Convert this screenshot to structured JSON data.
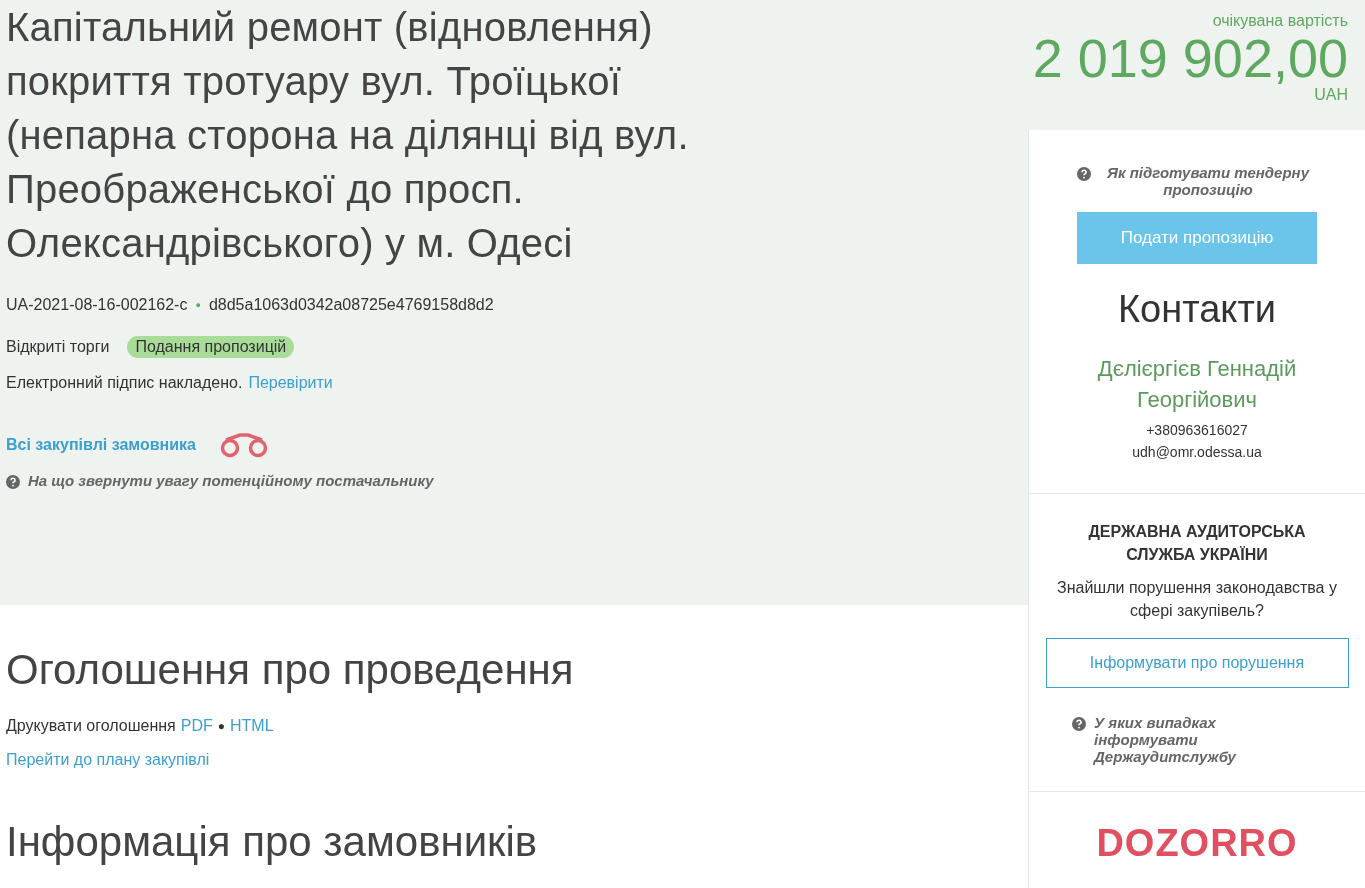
{
  "tender": {
    "title": "Капітальний ремонт (відновлення) покриття тротуару вул. Троїцької (непарна сторона на ділянці від вул. Преображенської до просп. Олександрівського) у м. Одесі",
    "id": "UA-2021-08-16-002162-c",
    "separator": "●",
    "hash": "d8d5a1063d0342a08725e4769158d8d2",
    "procedure": "Відкриті торги",
    "status": "Подання пропозицій",
    "signature_text": "Електронний підпис накладено.",
    "signature_link": "Перевірити",
    "buyer_link": "Всі закупівлі замовника",
    "hint": "На що звернути увагу потенційному постачальнику"
  },
  "budget": {
    "label": "очікувана вартість",
    "amount": "2 019 902,00",
    "currency": "UAH"
  },
  "sidebar": {
    "hint": "Як підготувати тендерну пропозицію",
    "submit_button": "Подати пропозицію",
    "contacts_title": "Контакти",
    "contact_name": "Дєлієргієв Геннадій Георгійович",
    "phone": "+380963616027",
    "email": "udh@omr.odessa.ua",
    "audit": {
      "title": "ДЕРЖАВНА АУДИТОРСЬКА СЛУЖБА УКРАЇНИ",
      "question": "Знайшли порушення законодавства у сфері закупівель?",
      "button": "Інформувати про порушення",
      "hint": "У яких випадках інформувати Держаудитслужбу"
    },
    "logo": "DOZORRO"
  },
  "announcement": {
    "heading": "Оголошення про проведення",
    "print_label": "Друкувати оголошення",
    "pdf": "PDF",
    "separator": "●",
    "html": "HTML",
    "plan_link": "Перейти до плану закупівлі"
  },
  "customers": {
    "heading": "Інформація про замовників"
  }
}
